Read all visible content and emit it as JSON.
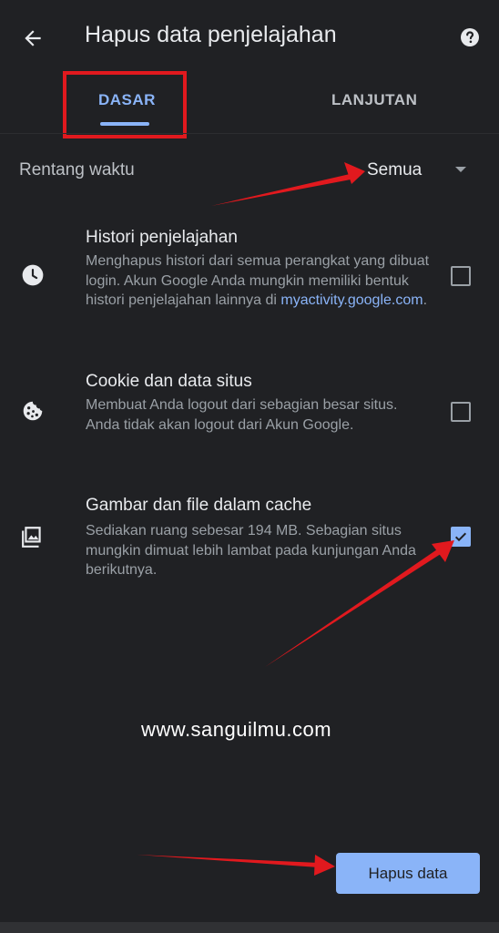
{
  "header": {
    "title": "Hapus data penjelajahan",
    "back_icon": "arrow-back-icon",
    "help_icon": "help-icon"
  },
  "tabs": [
    {
      "label": "DASAR",
      "selected": true
    },
    {
      "label": "LANJUTAN",
      "selected": false
    }
  ],
  "time_range": {
    "label": "Rentang waktu",
    "value": "Semua"
  },
  "options": [
    {
      "icon": "clock-icon",
      "title": "Histori penjelajahan",
      "description": "Menghapus histori dari semua perangkat yang dibuat login. Akun Google Anda mungkin memiliki bentuk histori penjelajahan lainnya di ",
      "link_text": "myactivity.google.com",
      "description_suffix": ".",
      "checked": false
    },
    {
      "icon": "cookie-icon",
      "title": "Cookie dan data situs",
      "description": "Membuat Anda logout dari sebagian besar situs. Anda tidak akan logout dari Akun Google.",
      "checked": false
    },
    {
      "icon": "image-icon",
      "title": "Gambar dan file dalam cache",
      "description": "Sediakan ruang sebesar 194 MB. Sebagian situs mungkin dimuat lebih lambat pada kunjungan Anda berikutnya.",
      "checked": true
    }
  ],
  "watermark": "www.sanguilmu.com",
  "actions": {
    "clear_label": "Hapus data"
  },
  "colors": {
    "background": "#202124",
    "accent": "#8ab4f8",
    "annotation": "#e1191e"
  }
}
